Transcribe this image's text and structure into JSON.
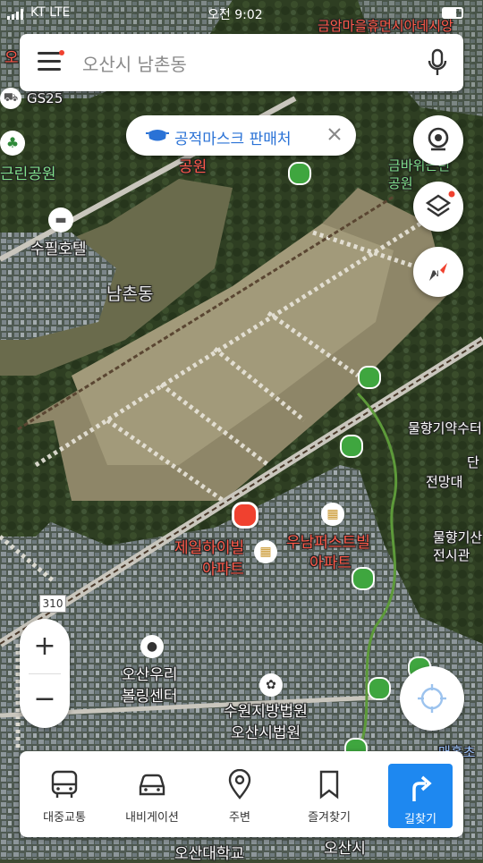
{
  "status": {
    "carrier": "KT  LTE",
    "time": "오전 9:02"
  },
  "search": {
    "placeholder": "오산시 남촌동",
    "menu_icon": "menu-icon",
    "mic_icon": "microphone-icon"
  },
  "notice_chip": {
    "label": "공적마스크 판매처"
  },
  "map_labels": {
    "gs25": "GS25",
    "park_left": "근린공원",
    "park_right": "금바위근린공원",
    "hotel": "수필호텔",
    "neighborhood": "남촌동",
    "top_right": "금암마을휴먼시아데시앙",
    "apt_left_1": "제일하이빌",
    "apt_left_2": "아파트",
    "apt_right_1": "우남퍼스트빌",
    "apt_right_2": "아파트",
    "bowling_1": "오산우리",
    "bowling_2": "볼링센터",
    "court_1": "수원지방법원",
    "court_2": "오산시법원",
    "road_310": "310",
    "mulhyang": "물향기약수터",
    "jeonmangdae": "전망대",
    "mulhyang2": "물향기산",
    "exhibit": "전시관",
    "dan": "단",
    "university": "오산대학교",
    "osan_city": "오산시",
    "maehol": "매홀초",
    "top_left": "오",
    "top_mid": "공원"
  },
  "zoom": {
    "plus": "+",
    "minus": "−"
  },
  "bottom_nav": [
    {
      "label": "대중교통",
      "icon": "bus-icon"
    },
    {
      "label": "내비게이션",
      "icon": "car-icon"
    },
    {
      "label": "주변",
      "icon": "location-pin-icon"
    },
    {
      "label": "즐겨찾기",
      "icon": "bookmark-icon"
    }
  ],
  "route_button": {
    "label": "길찾기",
    "icon": "turn-right-arrow-icon"
  },
  "colors": {
    "accent": "#1e88f0",
    "chip_text": "#2a72d6",
    "marker": "#f0412f"
  }
}
